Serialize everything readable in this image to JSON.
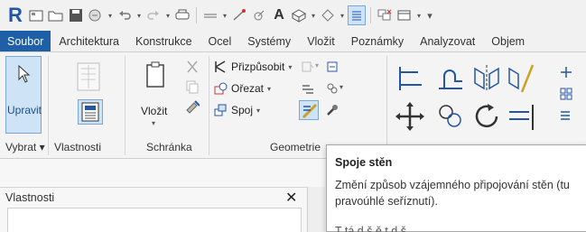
{
  "quick_access": {
    "logo": "R",
    "icons": [
      "home-icon",
      "open-icon",
      "save-icon",
      "sync-icon",
      "undo-icon",
      "redo-icon",
      "print-icon",
      "measure-icon",
      "dimension-icon",
      "tag-icon",
      "text-icon",
      "3d-view-icon",
      "section-icon",
      "thin-lines-icon",
      "close-hidden-icon",
      "switch-windows-icon",
      "customize-icon"
    ],
    "logo_color": "#2456a8"
  },
  "tabs": [
    "Soubor",
    "Architektura",
    "Konstrukce",
    "Ocel",
    "Systémy",
    "Vložit",
    "Poznámky",
    "Analyzovat",
    "Objem"
  ],
  "active_tab": "Soubor",
  "ribbon": {
    "upravit_label": "Upravit",
    "vlozit_label": "Vložit",
    "prizpusobit_label": "Přizpůsobit",
    "orezat_label": "Ořezat",
    "spoj_label": "Spoj",
    "panels": {
      "vybrat": "Vybrat",
      "vlastnosti": "Vlastnosti",
      "schranka": "Schránka",
      "geometrie": "Geometrie"
    }
  },
  "properties_palette": {
    "title": "Vlastnosti",
    "close": "✕"
  },
  "tooltip": {
    "title": "Spoje stěn",
    "line1": "Změní způsob vzájemného připojování stěn (tu",
    "line2": "pravoúhlé seříznutí).",
    "line3": "T          tá     d         š      ě                  t    d  š"
  },
  "colors": {
    "accent": "#1f5fa8",
    "active_button": "#cfe3f7",
    "active_border": "#7aa7d8"
  }
}
